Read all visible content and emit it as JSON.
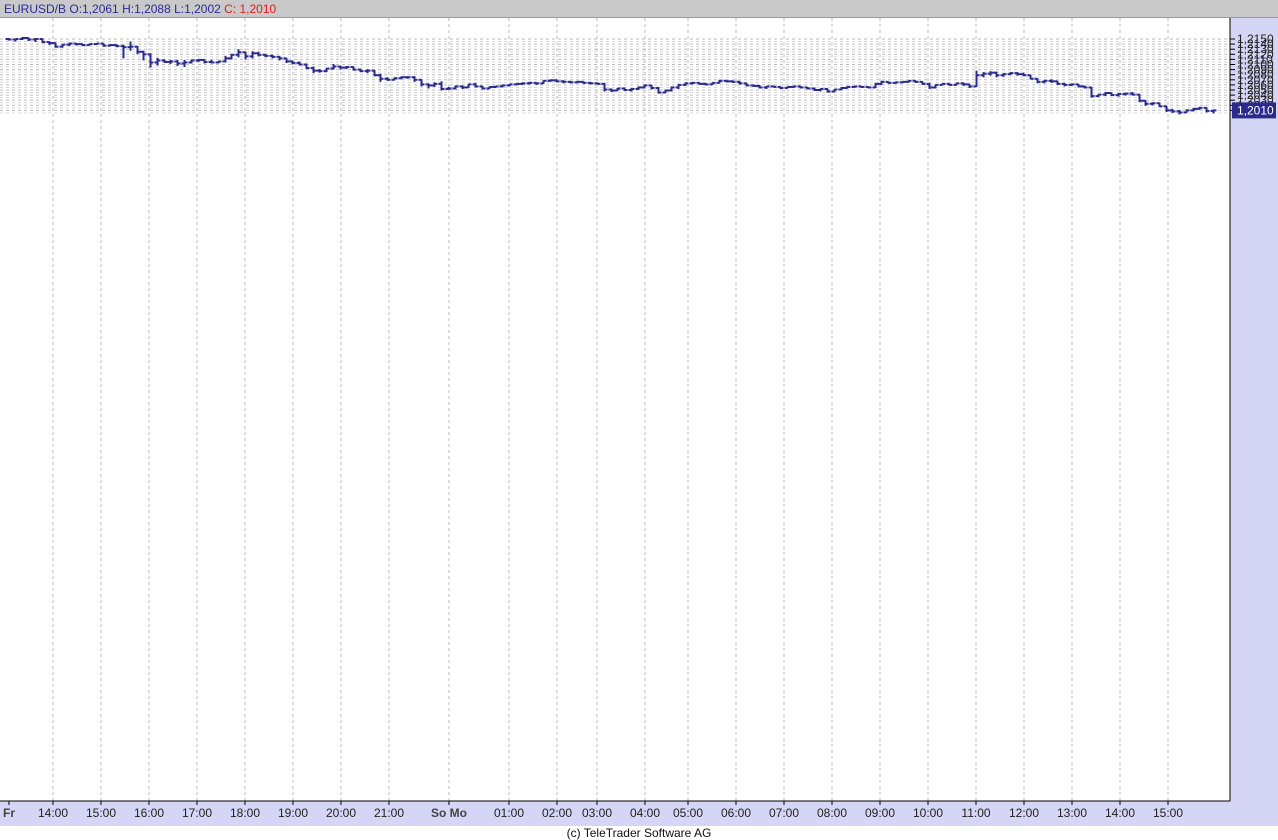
{
  "header": {
    "symbol": "EURUSD/B",
    "ohlc": "O:1,2061  H:1,2088  L:1,2002",
    "close": "C: 1,2010"
  },
  "footer": {
    "copyright": "(c) TeleTrader Software AG"
  },
  "colors": {
    "bar": "#2a2a8c",
    "axis_panel": "#d5d5f5",
    "grid": "#bdbdbd",
    "header_bg": "#c9c9c9",
    "close_text": "#e21b1b",
    "last_price_bg": "#2a2a8c"
  },
  "chart_data": {
    "type": "ohlc",
    "title": "",
    "ylim": [
      1.2,
      1.2156
    ],
    "y_ticks": [
      "1,2150",
      "1,2140",
      "1,2130",
      "1,2120",
      "1,2110",
      "1,2100",
      "1,2090",
      "1,2080",
      "1,2070",
      "1,2060",
      "1,2050",
      "1,2040",
      "1,2030",
      "1,2020",
      "1,2010"
    ],
    "x_ticks": [
      "Fr",
      "14:00",
      "15:00",
      "16:00",
      "17:00",
      "18:00",
      "19:00",
      "20:00",
      "21:00",
      "So Mo",
      "01:00",
      "02:00",
      "03:00",
      "04:00",
      "05:00",
      "06:00",
      "07:00",
      "08:00",
      "09:00",
      "10:00",
      "11:00",
      "12:00",
      "13:00",
      "14:00",
      "15:00"
    ],
    "last_price": "1,2010",
    "ohlc": [
      [
        1.215,
        1.2152,
        1.2147,
        1.2149
      ],
      [
        1.2149,
        1.2151,
        1.2145,
        1.215
      ],
      [
        1.215,
        1.2154,
        1.2148,
        1.2152
      ],
      [
        1.2152,
        1.2153,
        1.2146,
        1.2149
      ],
      [
        1.2149,
        1.2152,
        1.2144,
        1.215
      ],
      [
        1.215,
        1.2151,
        1.2142,
        1.2144
      ],
      [
        1.2144,
        1.2145,
        1.2138,
        1.2142
      ],
      [
        1.2142,
        1.2143,
        1.2133,
        1.2135
      ],
      [
        1.2135,
        1.214,
        1.2133,
        1.2139
      ],
      [
        1.2139,
        1.2143,
        1.2136,
        1.2141
      ],
      [
        1.2141,
        1.2142,
        1.2137,
        1.214
      ],
      [
        1.214,
        1.2141,
        1.2136,
        1.2138
      ],
      [
        1.2138,
        1.2141,
        1.2137,
        1.214
      ],
      [
        1.214,
        1.2142,
        1.2138,
        1.2141
      ],
      [
        1.2141,
        1.2142,
        1.2135,
        1.2137
      ],
      [
        1.2137,
        1.214,
        1.2136,
        1.2138
      ],
      [
        1.2138,
        1.214,
        1.2134,
        1.2136
      ],
      [
        1.2136,
        1.2139,
        1.2112,
        1.2134
      ],
      [
        1.2134,
        1.2145,
        1.2127,
        1.2135
      ],
      [
        1.2135,
        1.2136,
        1.212,
        1.2125
      ],
      [
        1.2125,
        1.2127,
        1.2108,
        1.212
      ],
      [
        1.212,
        1.2122,
        1.2094,
        1.2104
      ],
      [
        1.2104,
        1.2113,
        1.2098,
        1.2108
      ],
      [
        1.2108,
        1.211,
        1.2103,
        1.2105
      ],
      [
        1.2105,
        1.2109,
        1.2101,
        1.2106
      ],
      [
        1.2106,
        1.2109,
        1.2097,
        1.2102
      ],
      [
        1.2102,
        1.2109,
        1.2095,
        1.2104
      ],
      [
        1.2104,
        1.211,
        1.2102,
        1.2108
      ],
      [
        1.2108,
        1.2111,
        1.2105,
        1.2109
      ],
      [
        1.2109,
        1.211,
        1.2102,
        1.2105
      ],
      [
        1.2105,
        1.2109,
        1.2102,
        1.2104
      ],
      [
        1.2104,
        1.2107,
        1.2102,
        1.2106
      ],
      [
        1.2106,
        1.2117,
        1.2104,
        1.2112
      ],
      [
        1.2112,
        1.2121,
        1.211,
        1.2119
      ],
      [
        1.2119,
        1.213,
        1.2114,
        1.2124
      ],
      [
        1.2124,
        1.2125,
        1.211,
        1.2116
      ],
      [
        1.2116,
        1.2126,
        1.2112,
        1.2122
      ],
      [
        1.2122,
        1.2125,
        1.2116,
        1.2119
      ],
      [
        1.2119,
        1.2121,
        1.2114,
        1.2117
      ],
      [
        1.2117,
        1.2119,
        1.2112,
        1.2115
      ],
      [
        1.2115,
        1.2117,
        1.2108,
        1.2112
      ],
      [
        1.2112,
        1.2113,
        1.2103,
        1.2106
      ],
      [
        1.2106,
        1.2108,
        1.21,
        1.2103
      ],
      [
        1.2103,
        1.2106,
        1.2098,
        1.21
      ],
      [
        1.21,
        1.2102,
        1.2091,
        1.2093
      ],
      [
        1.2093,
        1.2096,
        1.2083,
        1.2088
      ],
      [
        1.2088,
        1.2091,
        1.2084,
        1.2087
      ],
      [
        1.2087,
        1.2093,
        1.2085,
        1.2092
      ],
      [
        1.2092,
        1.2101,
        1.209,
        1.2096
      ],
      [
        1.2096,
        1.2098,
        1.209,
        1.2094
      ],
      [
        1.2094,
        1.2097,
        1.2091,
        1.2095
      ],
      [
        1.2095,
        1.2096,
        1.2088,
        1.209
      ],
      [
        1.209,
        1.2092,
        1.2085,
        1.2087
      ],
      [
        1.2087,
        1.2091,
        1.2083,
        1.2088
      ],
      [
        1.2088,
        1.2089,
        1.2077,
        1.2079
      ],
      [
        1.2079,
        1.2082,
        1.2066,
        1.2072
      ],
      [
        1.2072,
        1.2075,
        1.2068,
        1.207
      ],
      [
        1.207,
        1.2075,
        1.2069,
        1.2073
      ],
      [
        1.2073,
        1.2077,
        1.2071,
        1.2075
      ],
      [
        1.2075,
        1.2077,
        1.2072,
        1.2075
      ],
      [
        1.2075,
        1.2077,
        1.2066,
        1.207
      ],
      [
        1.207,
        1.2071,
        1.2057,
        1.2061
      ],
      [
        1.2061,
        1.2063,
        1.2053,
        1.2059
      ],
      [
        1.2059,
        1.2065,
        1.2056,
        1.2062
      ],
      [
        1.2062,
        1.2067,
        1.2049,
        1.2052
      ],
      [
        1.2052,
        1.2056,
        1.205,
        1.2053
      ],
      [
        1.2053,
        1.2059,
        1.2051,
        1.2057
      ],
      [
        1.2057,
        1.2059,
        1.2052,
        1.2055
      ],
      [
        1.2055,
        1.2062,
        1.2054,
        1.2061
      ],
      [
        1.2061,
        1.2064,
        1.2055,
        1.2057
      ],
      [
        1.2057,
        1.2058,
        1.2051,
        1.2053
      ],
      [
        1.2053,
        1.2057,
        1.2052,
        1.2056
      ],
      [
        1.2056,
        1.2058,
        1.2054,
        1.2057
      ],
      [
        1.2057,
        1.2061,
        1.2055,
        1.2059
      ],
      [
        1.2059,
        1.2062,
        1.2057,
        1.2061
      ],
      [
        1.2061,
        1.2063,
        1.2059,
        1.2062
      ],
      [
        1.2062,
        1.2065,
        1.206,
        1.2063
      ],
      [
        1.2063,
        1.2066,
        1.2061,
        1.2064
      ],
      [
        1.2064,
        1.2065,
        1.206,
        1.2063
      ],
      [
        1.2063,
        1.2069,
        1.2062,
        1.2068
      ],
      [
        1.2068,
        1.2071,
        1.2066,
        1.2069
      ],
      [
        1.2069,
        1.2071,
        1.2065,
        1.2067
      ],
      [
        1.2067,
        1.2069,
        1.2063,
        1.2066
      ],
      [
        1.2066,
        1.2068,
        1.2063,
        1.2065
      ],
      [
        1.2065,
        1.2068,
        1.2063,
        1.2066
      ],
      [
        1.2066,
        1.2067,
        1.2062,
        1.2064
      ],
      [
        1.2064,
        1.2066,
        1.2061,
        1.2063
      ],
      [
        1.2063,
        1.2065,
        1.2061,
        1.2062
      ],
      [
        1.2062,
        1.2064,
        1.2047,
        1.2051
      ],
      [
        1.2051,
        1.2053,
        1.2046,
        1.2049
      ],
      [
        1.2049,
        1.2054,
        1.2048,
        1.2053
      ],
      [
        1.2053,
        1.2055,
        1.2048,
        1.205
      ],
      [
        1.205,
        1.2054,
        1.2047,
        1.2052
      ],
      [
        1.2052,
        1.2057,
        1.205,
        1.2055
      ],
      [
        1.2055,
        1.2061,
        1.2053,
        1.2059
      ],
      [
        1.2059,
        1.206,
        1.2051,
        1.2054
      ],
      [
        1.2054,
        1.2056,
        1.2043,
        1.2045
      ],
      [
        1.2045,
        1.2051,
        1.2044,
        1.2049
      ],
      [
        1.2049,
        1.2057,
        1.2047,
        1.2055
      ],
      [
        1.2055,
        1.2062,
        1.2052,
        1.206
      ],
      [
        1.206,
        1.2065,
        1.2058,
        1.2063
      ],
      [
        1.2063,
        1.2066,
        1.2061,
        1.2064
      ],
      [
        1.2064,
        1.2065,
        1.206,
        1.2062
      ],
      [
        1.2062,
        1.2064,
        1.2059,
        1.2061
      ],
      [
        1.2061,
        1.2065,
        1.206,
        1.2064
      ],
      [
        1.2064,
        1.207,
        1.2063,
        1.2068
      ],
      [
        1.2068,
        1.207,
        1.2065,
        1.2067
      ],
      [
        1.2067,
        1.2069,
        1.2064,
        1.2066
      ],
      [
        1.2066,
        1.2068,
        1.2061,
        1.2063
      ],
      [
        1.2063,
        1.2064,
        1.2057,
        1.2059
      ],
      [
        1.2059,
        1.2061,
        1.2056,
        1.2058
      ],
      [
        1.2058,
        1.206,
        1.2053,
        1.2055
      ],
      [
        1.2055,
        1.2058,
        1.2052,
        1.2057
      ],
      [
        1.2057,
        1.2059,
        1.2055,
        1.2056
      ],
      [
        1.2056,
        1.2057,
        1.2052,
        1.2054
      ],
      [
        1.2054,
        1.2057,
        1.2053,
        1.2056
      ],
      [
        1.2056,
        1.2058,
        1.2054,
        1.2057
      ],
      [
        1.2057,
        1.2058,
        1.2053,
        1.2055
      ],
      [
        1.2055,
        1.2056,
        1.2051,
        1.2053
      ],
      [
        1.2053,
        1.2055,
        1.2048,
        1.205
      ],
      [
        1.205,
        1.2053,
        1.2047,
        1.2052
      ],
      [
        1.2052,
        1.2053,
        1.2045,
        1.2047
      ],
      [
        1.2047,
        1.2052,
        1.2046,
        1.2051
      ],
      [
        1.2051,
        1.2056,
        1.205,
        1.2054
      ],
      [
        1.2054,
        1.2058,
        1.2053,
        1.2056
      ],
      [
        1.2056,
        1.2058,
        1.2054,
        1.2057
      ],
      [
        1.2057,
        1.2058,
        1.2054,
        1.2056
      ],
      [
        1.2056,
        1.2057,
        1.2053,
        1.2055
      ],
      [
        1.2055,
        1.2064,
        1.2054,
        1.2062
      ],
      [
        1.2062,
        1.2068,
        1.206,
        1.2066
      ],
      [
        1.2066,
        1.2067,
        1.2062,
        1.2064
      ],
      [
        1.2064,
        1.2066,
        1.2062,
        1.2065
      ],
      [
        1.2065,
        1.2067,
        1.2063,
        1.2066
      ],
      [
        1.2066,
        1.2069,
        1.2064,
        1.2068
      ],
      [
        1.2068,
        1.2069,
        1.2064,
        1.2066
      ],
      [
        1.2066,
        1.2067,
        1.206,
        1.2062
      ],
      [
        1.2062,
        1.2064,
        1.2052,
        1.2055
      ],
      [
        1.2055,
        1.2061,
        1.2053,
        1.206
      ],
      [
        1.206,
        1.2063,
        1.2059,
        1.2062
      ],
      [
        1.2062,
        1.2063,
        1.2058,
        1.206
      ],
      [
        1.206,
        1.2064,
        1.2059,
        1.2063
      ],
      [
        1.2063,
        1.2065,
        1.2058,
        1.2061
      ],
      [
        1.2061,
        1.2062,
        1.2054,
        1.2057
      ],
      [
        1.2057,
        1.2088,
        1.2056,
        1.2079
      ],
      [
        1.2079,
        1.2085,
        1.2075,
        1.2082
      ],
      [
        1.2082,
        1.2087,
        1.2078,
        1.2084
      ],
      [
        1.2084,
        1.2086,
        1.2075,
        1.2079
      ],
      [
        1.2079,
        1.2083,
        1.2076,
        1.2081
      ],
      [
        1.2081,
        1.2085,
        1.2079,
        1.2083
      ],
      [
        1.2083,
        1.2085,
        1.2078,
        1.2081
      ],
      [
        1.2081,
        1.2084,
        1.2077,
        1.2079
      ],
      [
        1.2079,
        1.208,
        1.2071,
        1.2072
      ],
      [
        1.2072,
        1.2073,
        1.2063,
        1.2066
      ],
      [
        1.2066,
        1.207,
        1.2063,
        1.2068
      ],
      [
        1.2068,
        1.2071,
        1.2064,
        1.2067
      ],
      [
        1.2067,
        1.2068,
        1.206,
        1.2062
      ],
      [
        1.2062,
        1.2064,
        1.2057,
        1.206
      ],
      [
        1.206,
        1.2063,
        1.2058,
        1.2061
      ],
      [
        1.2061,
        1.2062,
        1.2055,
        1.2057
      ],
      [
        1.2057,
        1.2059,
        1.2053,
        1.2055
      ],
      [
        1.2055,
        1.2056,
        1.2035,
        1.2038
      ],
      [
        1.2038,
        1.2042,
        1.2036,
        1.2041
      ],
      [
        1.2041,
        1.2046,
        1.2038,
        1.2044
      ],
      [
        1.2044,
        1.2045,
        1.2038,
        1.204
      ],
      [
        1.204,
        1.2044,
        1.2037,
        1.2042
      ],
      [
        1.2042,
        1.2045,
        1.2039,
        1.2043
      ],
      [
        1.2043,
        1.2046,
        1.2039,
        1.2041
      ],
      [
        1.2041,
        1.2042,
        1.2026,
        1.2029
      ],
      [
        1.2029,
        1.203,
        1.2019,
        1.2023
      ],
      [
        1.2023,
        1.2026,
        1.202,
        1.2024
      ],
      [
        1.2024,
        1.2025,
        1.2017,
        1.2018
      ],
      [
        1.2018,
        1.2019,
        1.2007,
        1.201
      ],
      [
        1.201,
        1.2013,
        1.2005,
        1.2008
      ],
      [
        1.2008,
        1.2011,
        1.2002,
        1.2006
      ],
      [
        1.2006,
        1.2012,
        1.2005,
        1.201
      ],
      [
        1.201,
        1.2015,
        1.2008,
        1.2013
      ],
      [
        1.2013,
        1.2017,
        1.2011,
        1.2015
      ],
      [
        1.2015,
        1.2016,
        1.2006,
        1.2009
      ],
      [
        1.2009,
        1.2012,
        1.2004,
        1.201
      ]
    ]
  }
}
